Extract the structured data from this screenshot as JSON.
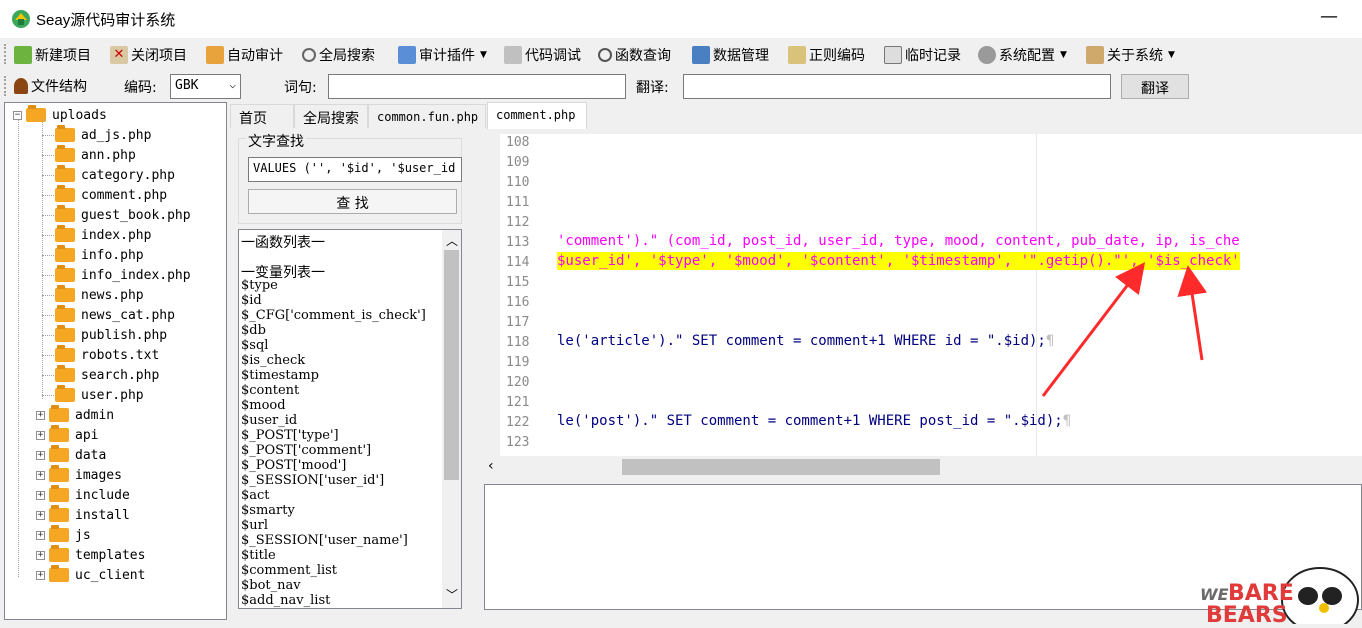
{
  "window": {
    "title": "Seay源代码审计系统",
    "minimize": "—"
  },
  "toolbar": {
    "items": [
      "新建项目",
      "关闭项目",
      "自动审计",
      "全局搜索",
      "审计插件",
      "代码调试",
      "函数查询",
      "数据管理",
      "正则编码",
      "临时记录",
      "系统配置",
      "关于系统"
    ]
  },
  "toolbar2": {
    "file_structure": "文件结构",
    "encoding_label": "编码:",
    "encoding_value": "GBK",
    "word_label": "词句:",
    "word_value": "",
    "translate_label": "翻译:",
    "translate_value": "",
    "translate_button": "翻译"
  },
  "tree": {
    "root": "uploads",
    "files": [
      "ad_js.php",
      "ann.php",
      "category.php",
      "comment.php",
      "guest_book.php",
      "index.php",
      "info.php",
      "info_index.php",
      "news.php",
      "news_cat.php",
      "publish.php",
      "robots.txt",
      "search.php",
      "user.php"
    ],
    "folders": [
      "admin",
      "api",
      "data",
      "images",
      "include",
      "install",
      "js",
      "templates",
      "uc_client"
    ]
  },
  "tabs": [
    "首页",
    "全局搜索",
    "common.fun.php",
    "comment.php"
  ],
  "search": {
    "group_title": "文字查找",
    "input_value": "VALUES ('', '$id', '$user_id",
    "button": "查 找"
  },
  "function_list": {
    "func_header": "一函数列表一",
    "var_header": "一变量列表一",
    "vars": [
      "$type",
      "$id",
      "$_CFG['comment_is_check']",
      "$db",
      "$sql",
      "$is_check",
      "$timestamp",
      "$content",
      "$mood",
      "$user_id",
      "$_POST['type']",
      "$_POST['comment']",
      "$_POST['mood']",
      "$_SESSION['user_id']",
      "$act",
      "$smarty",
      "$url",
      "$_SESSION['user_name']",
      "$title",
      "$comment_list",
      "$bot_nav",
      "$add_nav_list"
    ]
  },
  "editor": {
    "line_numbers": [
      "108",
      "109",
      "110",
      "111",
      "112",
      "113",
      "114",
      "115",
      "116",
      "117",
      "118",
      "119",
      "120",
      "121",
      "122",
      "123"
    ],
    "line113": "'comment').\" (com_id, post_id, user_id, type, mood, content, pub_date, ip, is_che",
    "line114": "$user_id', '$type', '$mood', '$content', '$timestamp', '\".getip().\"', '$is_check'",
    "line118_a": "le('article').\" SET comment = comment+1 WHERE id = \".$id);",
    "line122_a": "le('post').\" SET comment = comment+1 WHERE post_id = \".$id);",
    "pilcrow": "¶"
  },
  "colors": {
    "string": "#ff00ff",
    "highlight": "#ffff00",
    "arrow": "#ff2a2a"
  },
  "watermark": "WE BARE BEARS"
}
